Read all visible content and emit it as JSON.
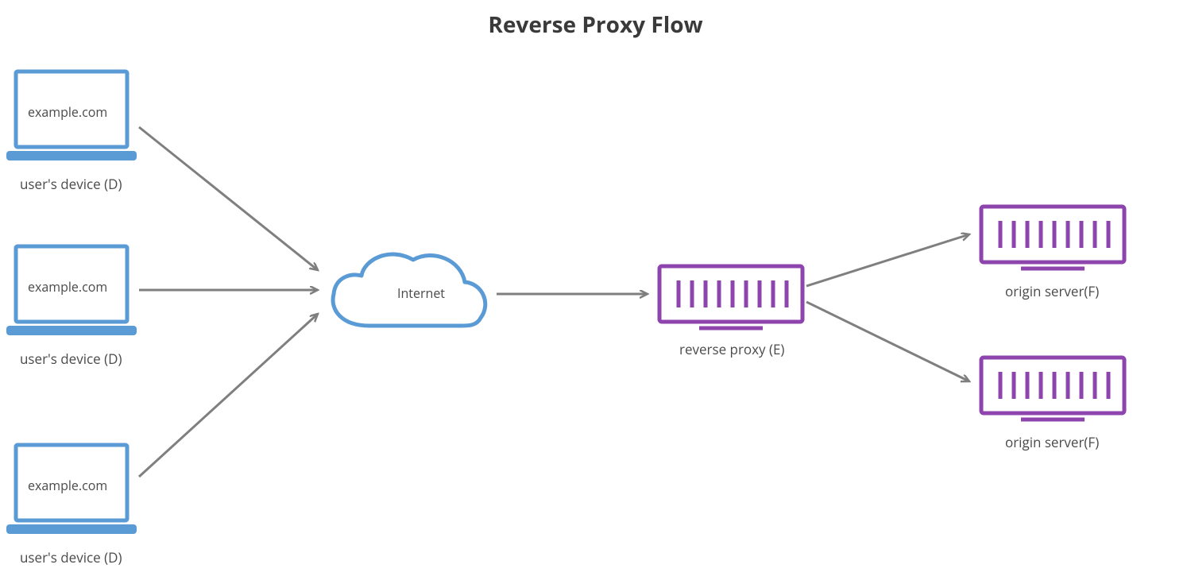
{
  "title": "Reverse Proxy Flow",
  "colors": {
    "blue": "#5B9BD5",
    "purple": "#8E44AD",
    "arrow": "#7F7F7F",
    "text": "#4a4a4a"
  },
  "devices": [
    {
      "screen": "example.com",
      "label": "user's device (D)"
    },
    {
      "screen": "example.com",
      "label": "user's device (D)"
    },
    {
      "screen": "example.com",
      "label": "user's device (D)"
    }
  ],
  "cloud": {
    "label": "Internet"
  },
  "reverse_proxy": {
    "label": "reverse proxy (E)"
  },
  "origin_servers": [
    {
      "label": "origin server(F)"
    },
    {
      "label": "origin server(F)"
    }
  ]
}
